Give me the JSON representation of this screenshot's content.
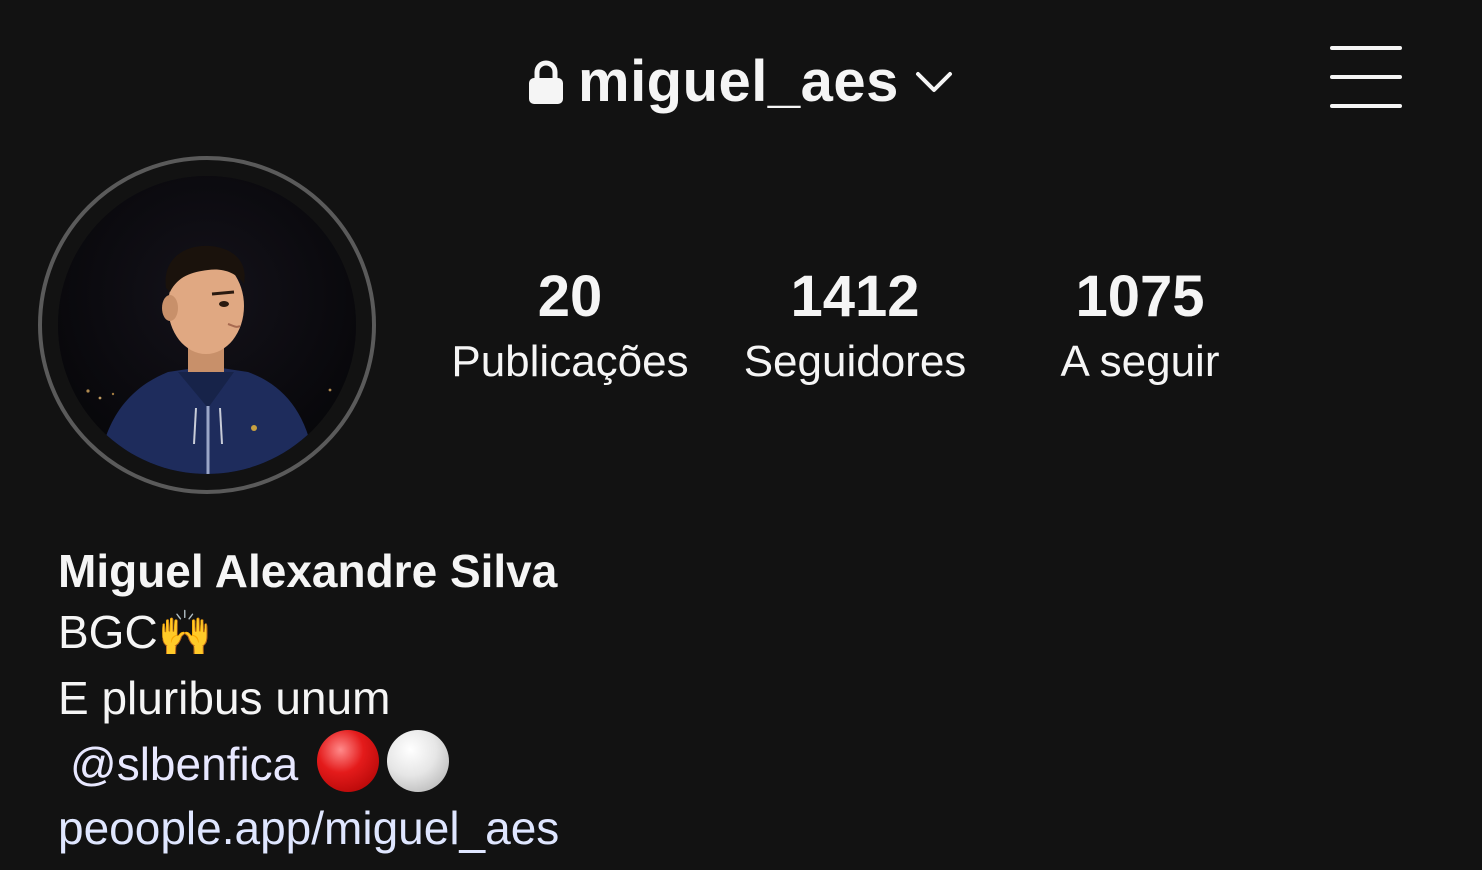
{
  "header": {
    "username": "miguel_aes",
    "lock_icon": "lock-icon",
    "switch_icon": "chevron-down-icon",
    "menu_icon": "hamburger-menu-icon"
  },
  "profile": {
    "avatar_icon": "profile-photo",
    "stats": [
      {
        "count": "20",
        "label": "Publicações"
      },
      {
        "count": "1412",
        "label": "Seguidores"
      },
      {
        "count": "1075",
        "label": "A seguir"
      }
    ]
  },
  "bio": {
    "name": "Miguel Alexandre Silva",
    "line1": "BGC",
    "line1_emoji": "🙌",
    "line2": "E pluribus unum",
    "mention": "@slbenfica",
    "mention_emojis": [
      "red-circle",
      "white-circle"
    ],
    "link": "peoople.app/miguel_aes"
  },
  "colors": {
    "background": "#121212",
    "text": "#f5f5f5",
    "avatar_ring": "#5a5a5a",
    "link": "#dfe6ff"
  }
}
